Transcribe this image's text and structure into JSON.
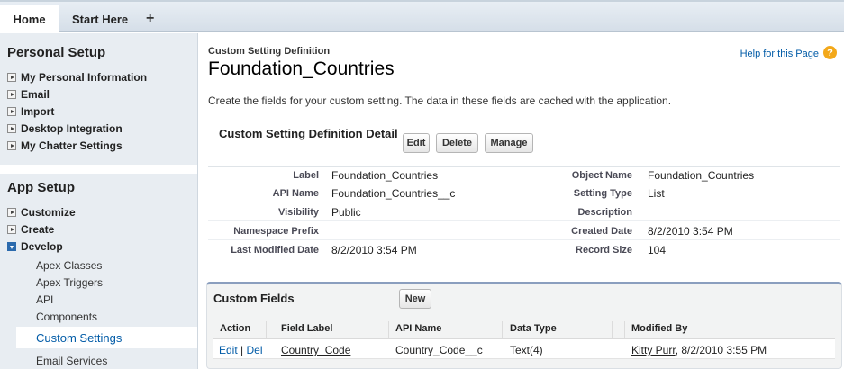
{
  "tabs": {
    "home": "Home",
    "start_here": "Start Here",
    "add": "+"
  },
  "sidebar": {
    "personal_setup": {
      "title": "Personal Setup",
      "items": [
        "My Personal Information",
        "Email",
        "Import",
        "Desktop Integration",
        "My Chatter Settings"
      ]
    },
    "app_setup": {
      "title": "App Setup",
      "items": [
        "Customize",
        "Create",
        "Develop"
      ],
      "develop_children": [
        "Apex Classes",
        "Apex Triggers",
        "API",
        "Components",
        "Custom Settings",
        "Email Services"
      ],
      "selected": "Custom Settings"
    }
  },
  "header": {
    "breadcrumb": "Custom Setting Definition",
    "title": "Foundation_Countries",
    "help_link": "Help for this Page",
    "help_icon": "?",
    "description": "Create the fields for your custom setting. The data in these fields are cached with the application."
  },
  "detail": {
    "heading": "Custom Setting Definition Detail",
    "buttons": {
      "edit": "Edit",
      "delete": "Delete",
      "manage": "Manage"
    },
    "fields": {
      "label_label": "Label",
      "label_value": "Foundation_Countries",
      "api_name_label": "API Name",
      "api_name_value": "Foundation_Countries__c",
      "visibility_label": "Visibility",
      "visibility_value": "Public",
      "namespace_label": "Namespace Prefix",
      "namespace_value": "",
      "last_modified_label": "Last Modified Date",
      "last_modified_value": "8/2/2010 3:54 PM",
      "object_name_label": "Object Name",
      "object_name_value": "Foundation_Countries",
      "setting_type_label": "Setting Type",
      "setting_type_value": "List",
      "description_label": "Description",
      "description_value": "",
      "created_date_label": "Created Date",
      "created_date_value": "8/2/2010 3:54 PM",
      "record_size_label": "Record Size",
      "record_size_value": "104"
    }
  },
  "custom_fields": {
    "title": "Custom Fields",
    "new_button": "New",
    "columns": [
      "Action",
      "Field Label",
      "API Name",
      "Data Type",
      "Modified By"
    ],
    "rows": [
      {
        "edit": "Edit",
        "sep": "|",
        "del": "Del",
        "field_label": "Country_Code",
        "api_name": "Country_Code__c",
        "data_type": "Text(4)",
        "modified_user": "Kitty Purr",
        "modified_date": ", 8/2/2010 3:55 PM"
      }
    ]
  }
}
